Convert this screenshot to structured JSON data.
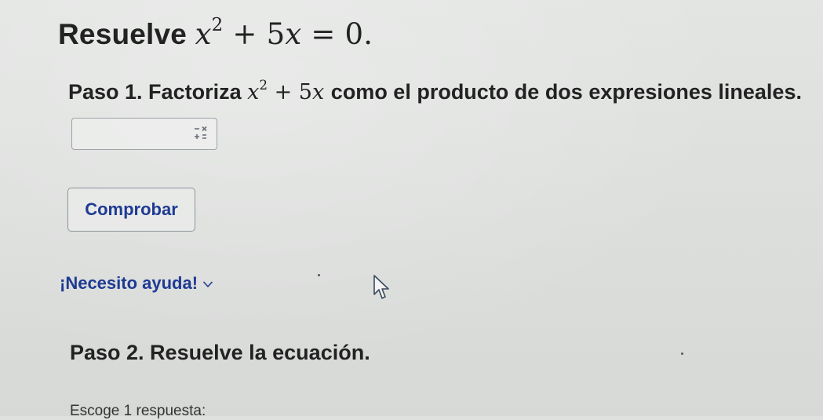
{
  "problem": {
    "prefix": "Resuelve",
    "equation": {
      "var": "x",
      "exp": "2",
      "middle": " + 5",
      "var2": "x",
      "rhs": " = 0."
    }
  },
  "step1": {
    "prefix": "Paso 1. Factoriza",
    "expr": {
      "var": "x",
      "exp": "2",
      "middle": " + 5",
      "var2": "x"
    },
    "suffix": "como el producto de dos expresiones lineales.",
    "answer_value": "",
    "keypad_icon": "math-keypad-icon"
  },
  "check_button": {
    "label": "Comprobar"
  },
  "help": {
    "label": "¡Necesito ayuda!",
    "icon": "chevron-down-icon"
  },
  "step2": {
    "label": "Paso 2. Resuelve la ecuación."
  },
  "answers_hint": {
    "label": "Escoge 1 respuesta:"
  },
  "colors": {
    "link": "#1f3a93",
    "text": "#222222",
    "border": "#9ea3a8"
  }
}
